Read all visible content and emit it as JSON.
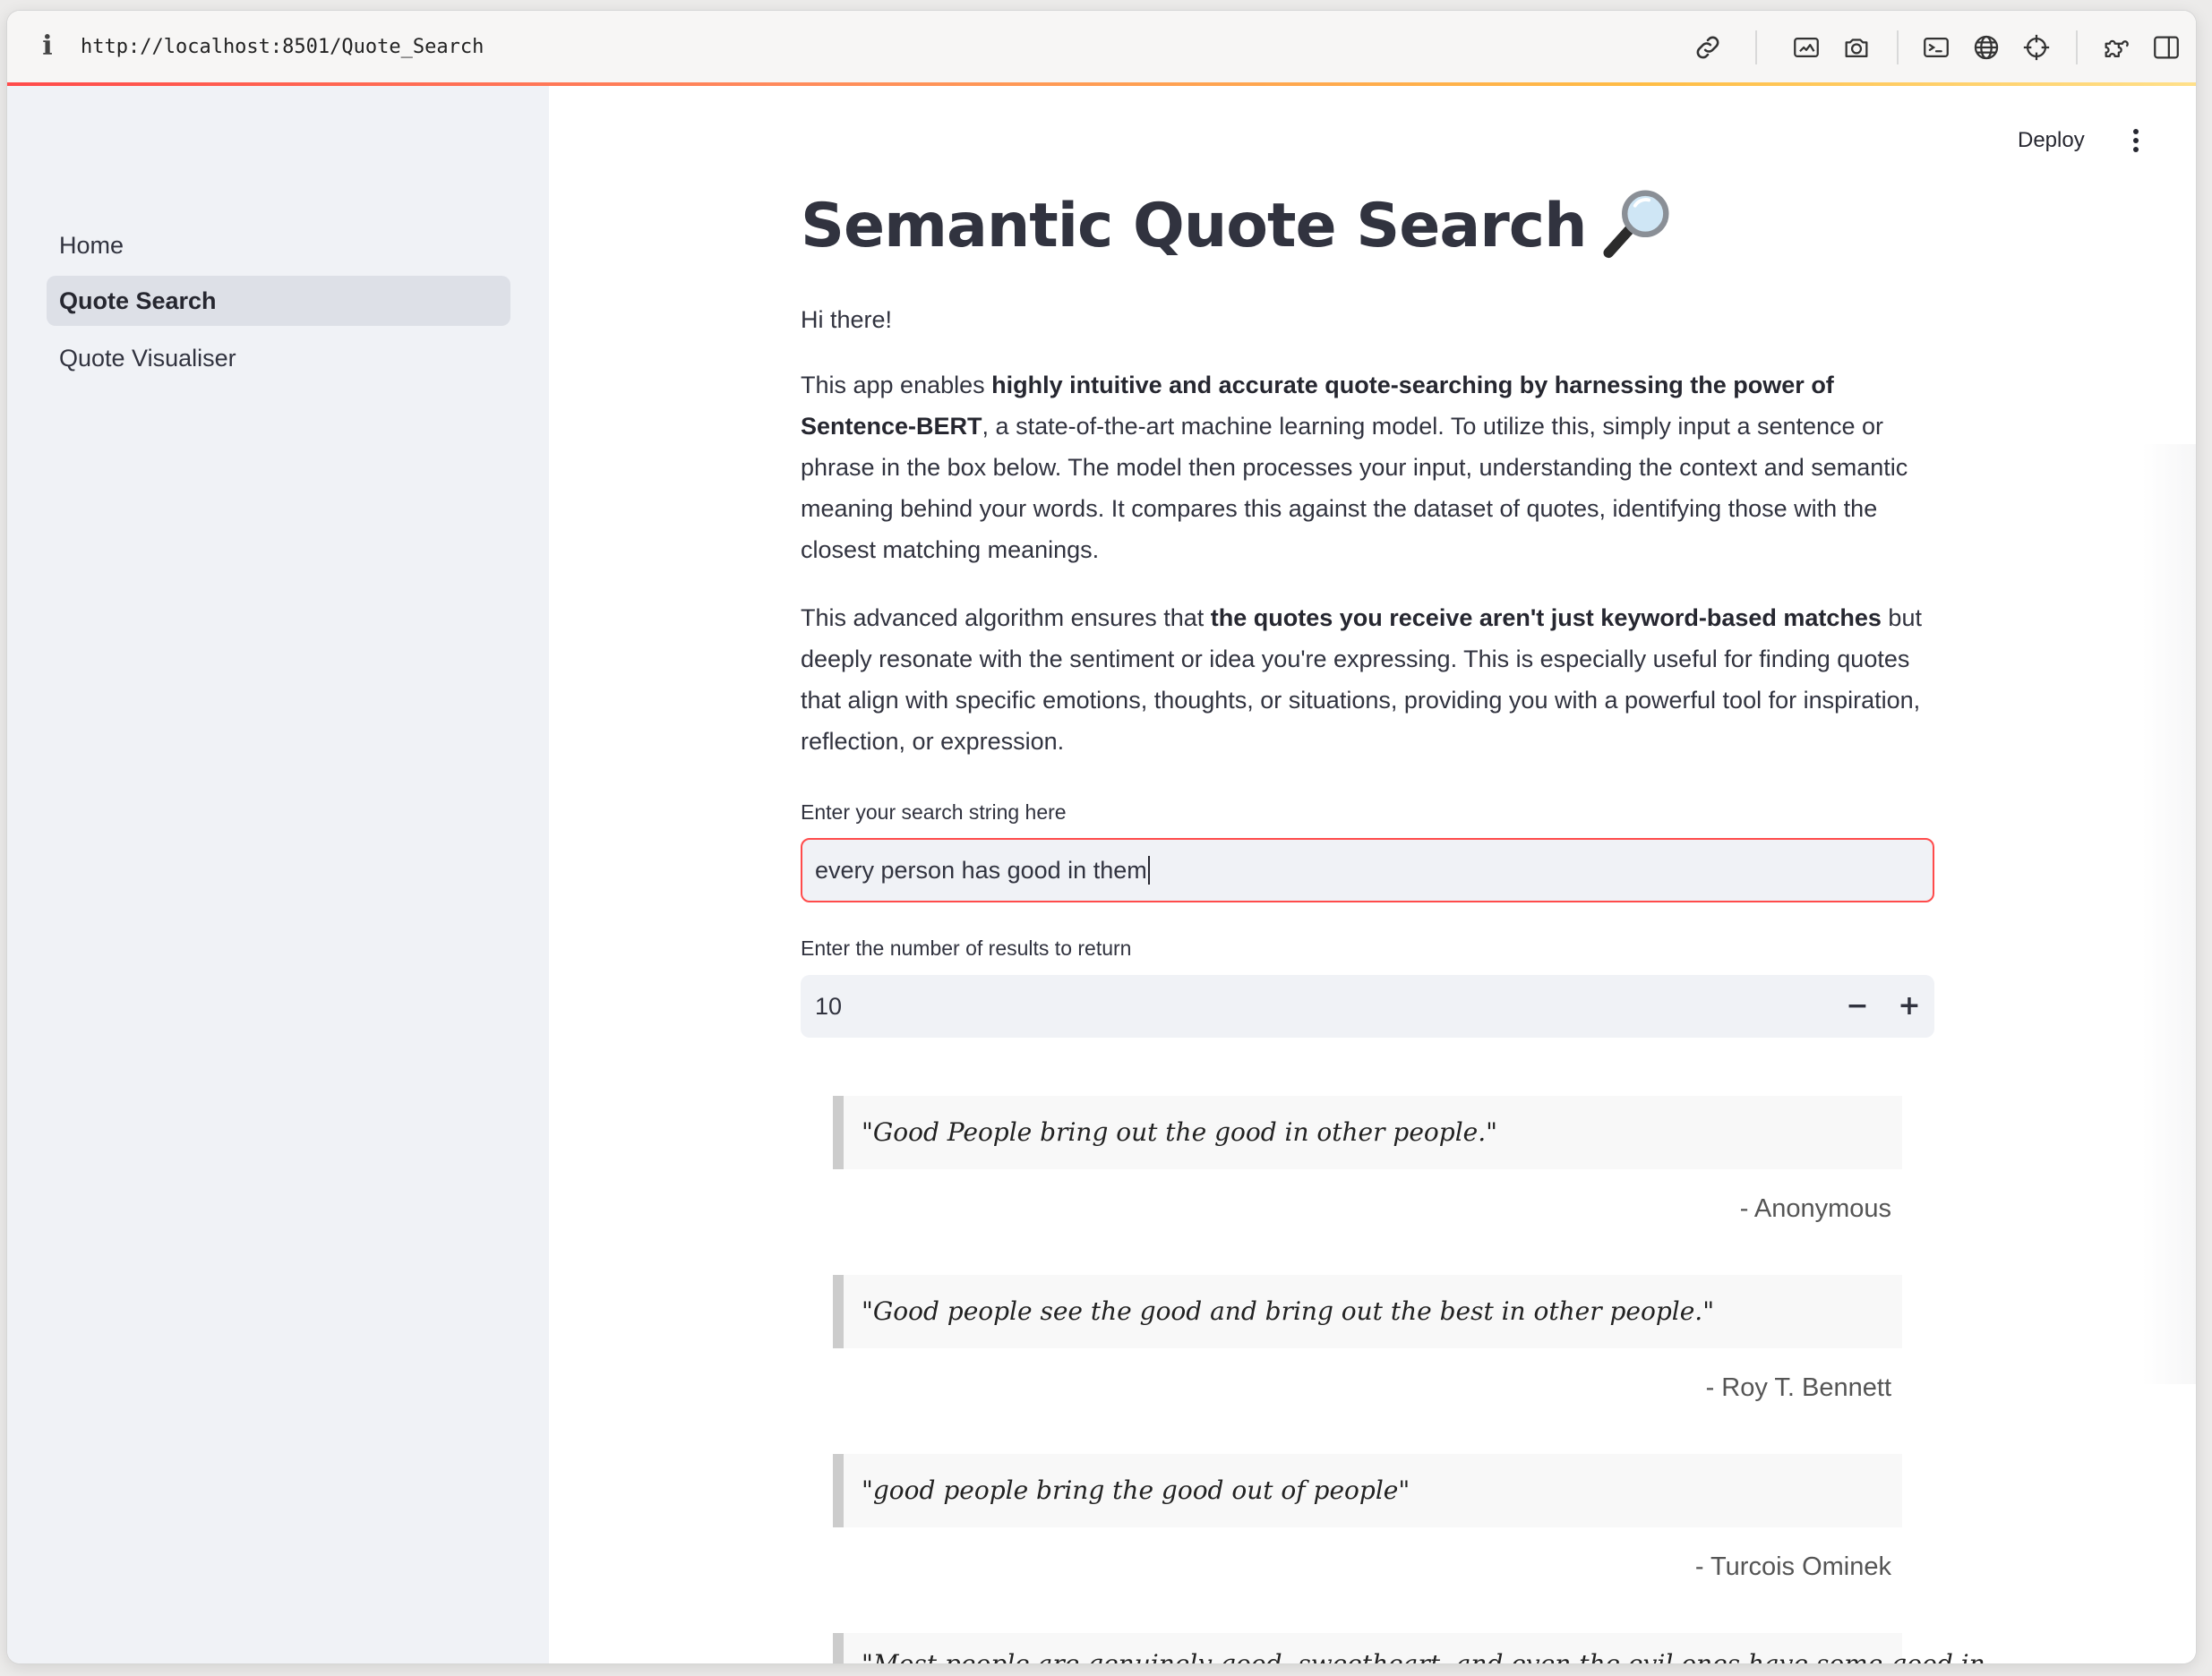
{
  "browser": {
    "url": "http://localhost:8501/Quote_Search"
  },
  "icons": {
    "info": "info-icon",
    "link": "link-icon",
    "screenshot": "screenshot-icon",
    "camera": "camera-icon",
    "terminal": "terminal-icon",
    "globe": "globe-icon",
    "crosshair": "crosshair-icon",
    "extensions": "puzzle-icon",
    "split_view": "split-view-icon",
    "title_emoji": "magnifying-glass-icon"
  },
  "colors": {
    "accent": "#ff4b4b",
    "sidebar_bg": "#f0f2f6",
    "text": "#31333f",
    "quote_bg": "#f8f8f8",
    "quote_border": "#cccccc"
  },
  "sidebar": {
    "items": [
      {
        "label": "Home",
        "active": false
      },
      {
        "label": "Quote Search",
        "active": true
      },
      {
        "label": "Quote Visualiser",
        "active": false
      }
    ]
  },
  "header": {
    "deploy_label": "Deploy"
  },
  "main": {
    "title": "Semantic Quote Search",
    "greeting": "Hi there!",
    "intro": {
      "p1_prefix": "This app enables ",
      "p1_bold": "highly intuitive and accurate quote-searching by harnessing the power of Sentence-BERT",
      "p1_suffix": ", a state-of-the-art machine learning model. To utilize this, simply input a sentence or phrase in the box below. The model then processes your input, understanding the context and semantic meaning behind your words. It compares this against the dataset of quotes, identifying those with the closest matching meanings.",
      "p2_prefix": "This advanced algorithm ensures that ",
      "p2_bold": "the quotes you receive aren't just keyword-based matches",
      "p2_suffix": " but deeply resonate with the sentiment or idea you're expressing. This is especially useful for finding quotes that align with specific emotions, thoughts, or situations, providing you with a powerful tool for inspiration, reflection, or expression."
    },
    "search": {
      "label": "Enter your search string here",
      "value": "every person has good in them"
    },
    "num_results": {
      "label": "Enter the number of results to return",
      "value": "10",
      "minus": "−",
      "plus": "+"
    },
    "results": [
      {
        "quote": "\"Good People bring out the good in other people.\"",
        "author": "- Anonymous"
      },
      {
        "quote": "\"Good people see the good and bring out the best in other people.\"",
        "author": "- Roy T. Bennett"
      },
      {
        "quote": "\"good people bring the good out of people\"",
        "author": "- Turcois Ominek"
      },
      {
        "quote": "\"Most people are genuinely good, sweetheart, and even the evil ones have some good in",
        "author": ""
      }
    ]
  }
}
